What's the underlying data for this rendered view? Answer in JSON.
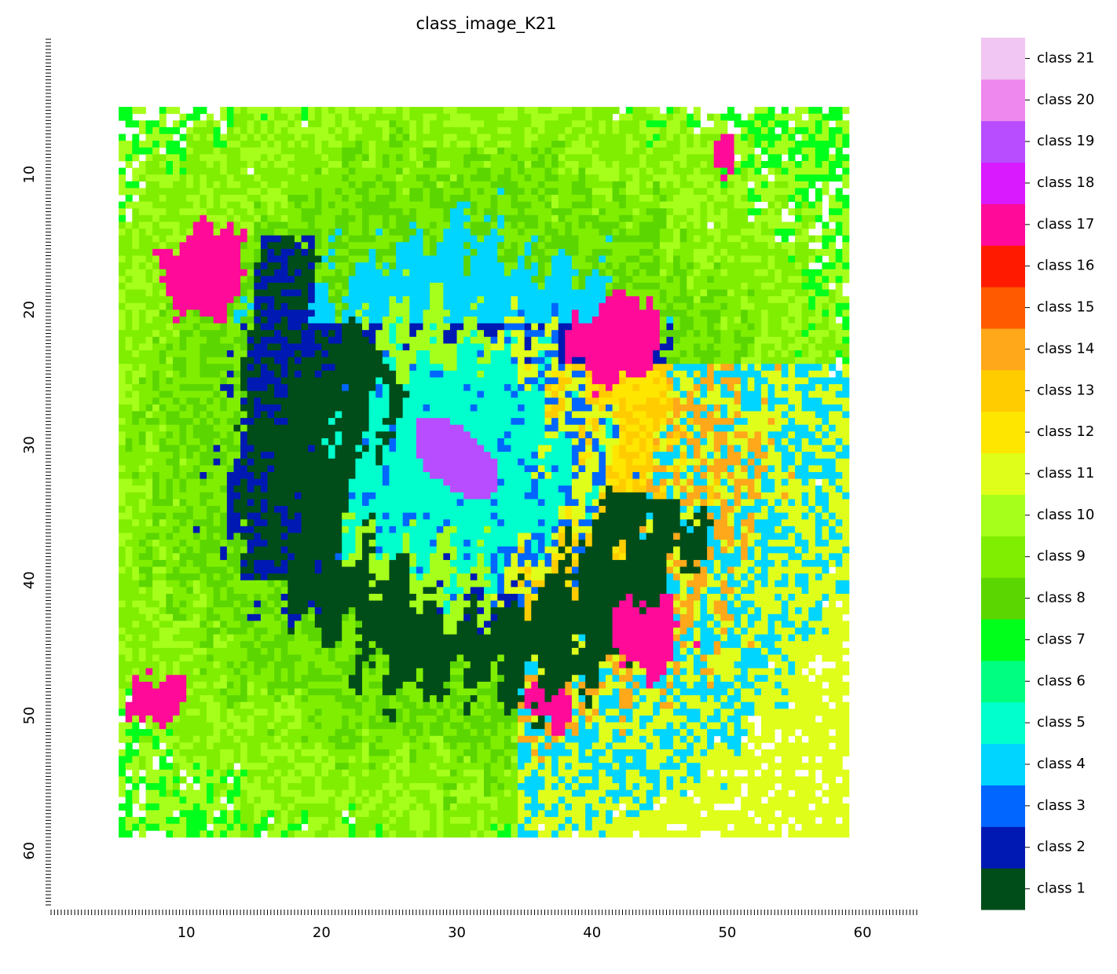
{
  "chart_data": {
    "type": "heatmap",
    "title": "class_image_K21",
    "xlabel": "",
    "ylabel": "",
    "x_range": [
      0,
      64
    ],
    "y_range": [
      0,
      64
    ],
    "x_ticks": [
      10,
      20,
      30,
      40,
      50,
      60
    ],
    "y_ticks": [
      10,
      20,
      30,
      40,
      50,
      60
    ],
    "image_extent": {
      "x": [
        5,
        59
      ],
      "y": [
        5,
        59
      ]
    },
    "grid": false,
    "colorbar": {
      "placement": "right",
      "classes": [
        {
          "label": "class 1",
          "color": "#004d1a"
        },
        {
          "label": "class 2",
          "color": "#0019b3"
        },
        {
          "label": "class 3",
          "color": "#0066ff"
        },
        {
          "label": "class 4",
          "color": "#00d5ff"
        },
        {
          "label": "class 5",
          "color": "#00ffcc"
        },
        {
          "label": "class 6",
          "color": "#00ff80"
        },
        {
          "label": "class 7",
          "color": "#00ff1a"
        },
        {
          "label": "class 8",
          "color": "#5cd600"
        },
        {
          "label": "class 9",
          "color": "#80ee00"
        },
        {
          "label": "class 10",
          "color": "#a6ff1a"
        },
        {
          "label": "class 11",
          "color": "#dfff1a"
        },
        {
          "label": "class 12",
          "color": "#ffe600"
        },
        {
          "label": "class 13",
          "color": "#ffcc00"
        },
        {
          "label": "class 14",
          "color": "#ffa81a"
        },
        {
          "label": "class 15",
          "color": "#ff5a00"
        },
        {
          "label": "class 16",
          "color": "#ff1a00"
        },
        {
          "label": "class 17",
          "color": "#ff0a99"
        },
        {
          "label": "class 18",
          "color": "#d91aff"
        },
        {
          "label": "class 19",
          "color": "#b84dff"
        },
        {
          "label": "class 20",
          "color": "#ee88ee"
        },
        {
          "label": "class 21",
          "color": "#f2c6f2"
        }
      ]
    }
  }
}
